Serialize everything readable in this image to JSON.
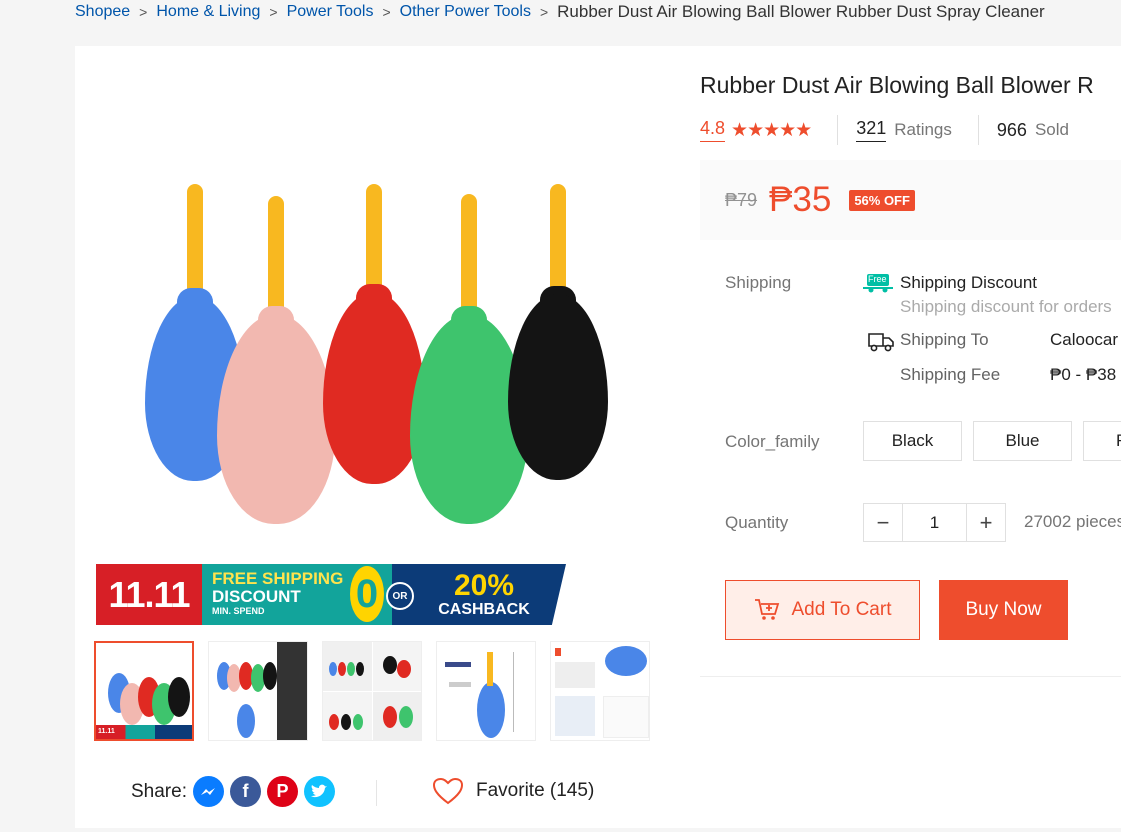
{
  "breadcrumb": {
    "items": [
      "Shopee",
      "Home & Living",
      "Power Tools",
      "Other Power Tools"
    ],
    "separator": ">",
    "current": "Rubber Dust Air Blowing Ball Blower Rubber Dust Spray Cleaner"
  },
  "product": {
    "title": "Rubber Dust Air Blowing Ball Blower R",
    "rating": "4.8",
    "stars": "★★★★★",
    "ratings_count": "321",
    "ratings_label": "Ratings",
    "sold_count": "966",
    "sold_label": "Sold"
  },
  "price": {
    "original": "₱79",
    "current": "₱35",
    "discount": "56% OFF"
  },
  "shipping": {
    "label": "Shipping",
    "free_tag": "Free",
    "discount_title": "Shipping Discount",
    "discount_sub": "Shipping discount for orders",
    "to_label": "Shipping To",
    "to_value": "Caloocar",
    "fee_label": "Shipping Fee",
    "fee_value": "₱0 - ₱38"
  },
  "variation": {
    "label": "Color_family",
    "options": [
      "Black",
      "Blue",
      "F"
    ]
  },
  "quantity": {
    "label": "Quantity",
    "minus": "−",
    "value": "1",
    "plus": "+",
    "stock": "27002 pieces"
  },
  "actions": {
    "add_to_cart": "Add To Cart",
    "buy_now": "Buy Now"
  },
  "promo_banner": {
    "date": "11.11",
    "line1": "FREE SHIPPING",
    "line2": "DISCOUNT",
    "line3": "MIN. SPEND",
    "zero": "0",
    "or": "OR",
    "percent": "20%",
    "cashback": "CASHBACK"
  },
  "share": {
    "label": "Share:",
    "networks": [
      "messenger-icon",
      "facebook-icon",
      "pinterest-icon",
      "twitter-icon"
    ]
  },
  "favorite": {
    "label": "Favorite (145)"
  },
  "colors": {
    "accent": "#ee4d2d",
    "link": "#0055aa",
    "bulb_blue": "#4a86e8",
    "bulb_pink": "#f2b8b0",
    "bulb_red": "#e02a22",
    "bulb_green": "#3ec46d",
    "bulb_black": "#141414",
    "nozzle": "#f8b820"
  }
}
